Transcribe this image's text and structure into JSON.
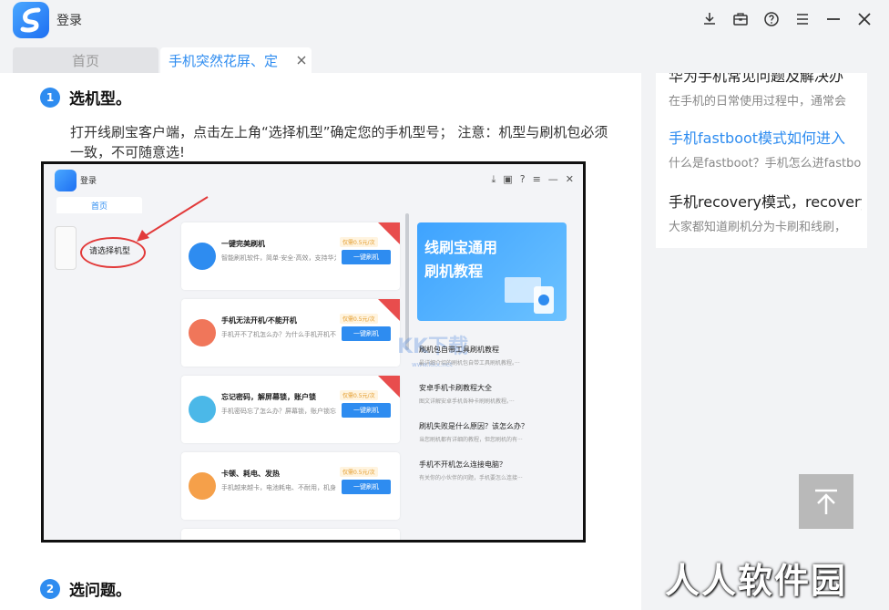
{
  "window": {
    "title": "登录",
    "icons": [
      "download-icon",
      "toolbox-icon",
      "help-icon",
      "menu-icon",
      "minimize-icon",
      "close-icon"
    ]
  },
  "tabs": [
    {
      "label": "首页",
      "active": false
    },
    {
      "label": "手机突然花屏、定",
      "active": true
    }
  ],
  "article": {
    "steps": [
      {
        "number": "1",
        "title": "选机型。"
      },
      {
        "number": "2",
        "title": "选问题。"
      }
    ],
    "paragraph": "打开线刷宝客户端，点击左上角“选择机型”确定您的手机型号； 注意：机型与刷机包必须一致，不可随意选!"
  },
  "screenshot": {
    "title": "登录",
    "tab": "首页",
    "choose_model": "请选择机型",
    "cards": [
      {
        "title": "一键完美刷机",
        "desc": "智能刷机软件，简单·安全·高效，支持华为、小米、VIVO、三星、乐视···",
        "badge": "仅需0.5元/次",
        "button": "一键刷机",
        "color": "#2e8cf0"
      },
      {
        "title": "手机无法开机/不能开机",
        "desc": "手机开不了机怎么办？为什么手机开机不能开机的原因及解决办···",
        "badge": "仅需0.5元/次",
        "button": "一键刷机",
        "color": "#f0765a"
      },
      {
        "title": "忘记密码，解屏幕锁，账户锁",
        "desc": "手机密码忘了怎么办？屏幕锁，账户锁忘记了怎么解？只需要一键可以···",
        "badge": "仅需0.5元/次",
        "button": "一键刷机",
        "color": "#4bb8e8"
      },
      {
        "title": "卡顿、耗电、发热",
        "desc": "手机越来越卡，电池耗电、不耐用，机身容易发烫，赶紧试试这个办法···",
        "badge": "仅需0.5元/次",
        "button": "一键刷机",
        "color": "#f5a04a"
      }
    ],
    "banner": {
      "line1": "线刷宝通用",
      "line2": "刷机教程"
    },
    "watermark": "KK下载",
    "watermark_url": "www.kkx.net",
    "side_items": [
      {
        "title": "刷机包自带工具刷机教程",
        "desc": "最详细介绍的刷机包自带工具刷机教程。···"
      },
      {
        "title": "安卓手机卡刷教程大全",
        "desc": "图文详解安卓手机各种卡刷刷机教程。···"
      },
      {
        "title": "刷机失败是什么原因？该怎么办？",
        "desc": "当您刷机都有详细的教程，但您刷机的有···"
      },
      {
        "title": "手机不开机怎么连接电脑？",
        "desc": "有关你的小伙伴的问题，手机要怎么连接···"
      }
    ]
  },
  "sidebar": [
    {
      "title": "华为手机常见问题及解决办",
      "desc": "在手机的日常使用过程中，通常会",
      "active": false
    },
    {
      "title": "手机fastboot模式如何进入",
      "desc": "什么是fastboot？手机怎么进fastboot",
      "active": true
    },
    {
      "title": "手机recovery模式，recovery",
      "desc": "大家都知道刷机分为卡刷和线刷，",
      "active": false
    }
  ],
  "brand_watermark": "人人软件园"
}
